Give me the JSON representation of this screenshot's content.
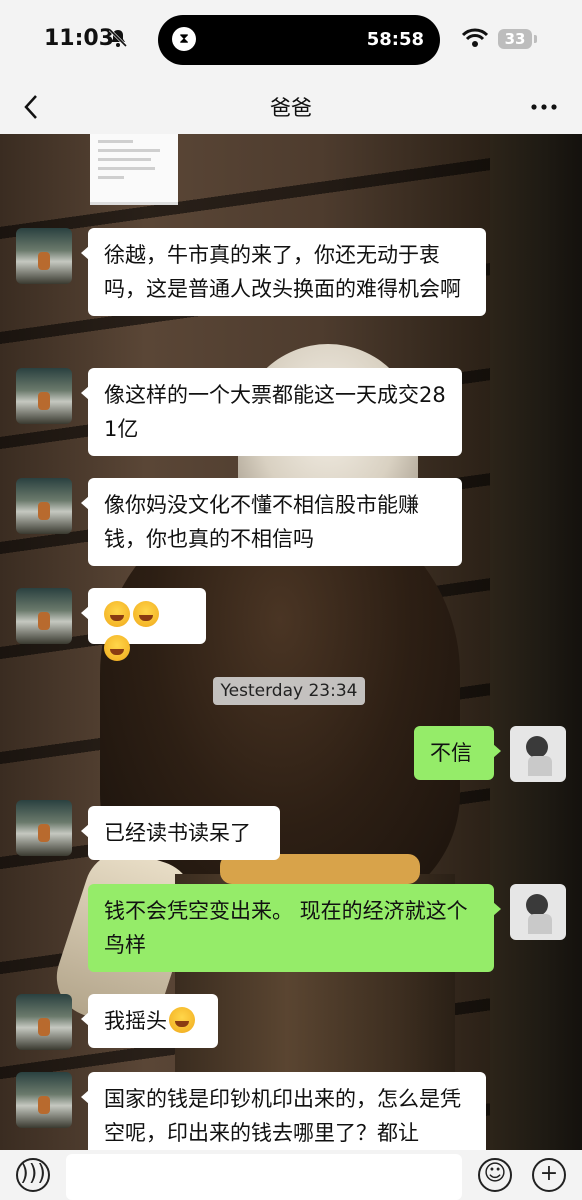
{
  "status_bar": {
    "time": "11:03",
    "timer": "58:58",
    "battery": "33"
  },
  "nav": {
    "title": "爸爸"
  },
  "messages": {
    "m1": "徐越，牛市真的来了，你还无动于衷吗，这是普通人改头换面的难得机会啊",
    "m2": "像这样的一个大票都能这一天成交281亿",
    "m3": "像你妈没文化不懂不相信股市能赚钱，你也真的不相信吗",
    "m5_timestamp": "Yesterday 23:34",
    "m6": "不信",
    "m7": "已经读书读呆了",
    "m8": "钱不会凭空变出来。 现在的经济就这个鸟样",
    "m9": "我摇头",
    "m10": "国家的钱是印钞机印出来的，怎么是凭空呢，印出来的钱去哪里了？都让"
  },
  "icons": {
    "bell": "bell-slash-icon",
    "emoji_laugh": "laughing-tears-emoji",
    "emoji_shake": "shaking-head-emoji"
  },
  "colors": {
    "incoming": "#ffffff",
    "outgoing": "#95ec69",
    "bar": "#f3f3f3"
  }
}
